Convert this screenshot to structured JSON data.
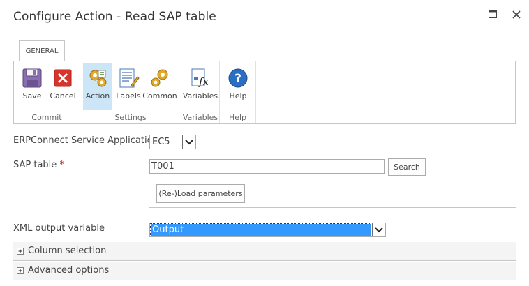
{
  "window": {
    "title": "Configure Action - Read SAP table",
    "maximize_icon": "maximize-icon",
    "close_icon": "close-icon"
  },
  "ribbon": {
    "tab_label": "GENERAL",
    "groups": [
      {
        "label": "Commit",
        "buttons": [
          {
            "label": "Save",
            "icon": "save-icon"
          },
          {
            "label": "Cancel",
            "icon": "cancel-icon"
          }
        ]
      },
      {
        "label": "Settings",
        "buttons": [
          {
            "label": "Action",
            "icon": "action-gears-icon",
            "active": true
          },
          {
            "label": "Labels",
            "icon": "labels-icon"
          },
          {
            "label": "Common",
            "icon": "common-gears-icon"
          }
        ]
      },
      {
        "label": "Variables",
        "buttons": [
          {
            "label": "Variables",
            "icon": "variables-fx-icon"
          }
        ]
      },
      {
        "label": "Help",
        "buttons": [
          {
            "label": "Help",
            "icon": "help-icon"
          }
        ]
      }
    ]
  },
  "form": {
    "service_app_label": "ERPConnect Service Application",
    "service_app_value": "EC5",
    "sap_table_label": "SAP table",
    "required_mark": "*",
    "sap_table_value": "T001",
    "search_label": "Search",
    "reload_label": "(Re-)Load parameters",
    "xml_output_label": "XML output variable",
    "xml_output_value": "Output"
  },
  "sections": [
    {
      "label": "Column selection",
      "icon": "expand-plus-icon"
    },
    {
      "label": "Advanced options",
      "icon": "expand-plus-icon"
    }
  ],
  "colors": {
    "selection_blue": "#3399ff",
    "active_button": "#cde6f7",
    "required_red": "#c00000"
  }
}
